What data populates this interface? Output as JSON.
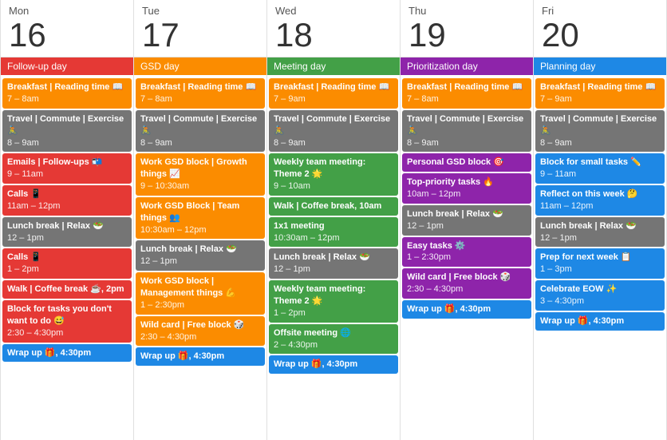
{
  "days": [
    {
      "name": "Mon",
      "number": "16",
      "tag": "Follow-up day",
      "tag_color": "bg-tag-red",
      "events": [
        {
          "title": "Breakfast | Reading time 📖",
          "time": "7 – 8am",
          "color": "bg-orange"
        },
        {
          "title": "Travel | Commute | Exercise 🚴",
          "time": "8 – 9am",
          "color": "bg-gray"
        },
        {
          "title": "Emails | Follow-ups 📬",
          "time": "9 – 11am",
          "color": "bg-red"
        },
        {
          "title": "Calls 📱",
          "time": "11am – 12pm",
          "color": "bg-red"
        },
        {
          "title": "Lunch break | Relax 🥗",
          "time": "12 – 1pm",
          "color": "bg-gray"
        },
        {
          "title": "Calls 📱",
          "time": "1 – 2pm",
          "color": "bg-red"
        },
        {
          "title": "Walk | Coffee break ☕, 2pm",
          "time": "",
          "color": "bg-red"
        },
        {
          "title": "Block for tasks you don't want to do 😅",
          "time": "2:30 – 4:30pm",
          "color": "bg-red"
        },
        {
          "title": "Wrap up 🎁, 4:30pm",
          "time": "",
          "color": "bg-blue"
        }
      ]
    },
    {
      "name": "Tue",
      "number": "17",
      "tag": "GSD day",
      "tag_color": "bg-tag-orange",
      "events": [
        {
          "title": "Breakfast | Reading time 📖",
          "time": "7 – 8am",
          "color": "bg-orange"
        },
        {
          "title": "Travel | Commute | Exercise 🚴",
          "time": "8 – 9am",
          "color": "bg-gray"
        },
        {
          "title": "Work GSD block | Growth things 📈",
          "time": "9 – 10:30am",
          "color": "bg-orange"
        },
        {
          "title": "Work GSD Block | Team things 👥",
          "time": "10:30am – 12pm",
          "color": "bg-orange"
        },
        {
          "title": "Lunch break | Relax 🥗",
          "time": "12 – 1pm",
          "color": "bg-gray"
        },
        {
          "title": "Work GSD block | Management things 💪",
          "time": "1 – 2:30pm",
          "color": "bg-orange"
        },
        {
          "title": "Wild card | Free block 🎲",
          "time": "2:30 – 4:30pm",
          "color": "bg-orange"
        },
        {
          "title": "Wrap up 🎁, 4:30pm",
          "time": "",
          "color": "bg-blue"
        }
      ]
    },
    {
      "name": "Wed",
      "number": "18",
      "tag": "Meeting day",
      "tag_color": "bg-tag-green",
      "events": [
        {
          "title": "Breakfast | Reading time 📖",
          "time": "7 – 9am",
          "color": "bg-orange"
        },
        {
          "title": "Travel | Commute | Exercise 🚴",
          "time": "8 – 9am",
          "color": "bg-gray"
        },
        {
          "title": "Weekly team meeting: Theme 2 🌟",
          "time": "9 – 10am",
          "color": "bg-green"
        },
        {
          "title": "Walk | Coffee break, 10am",
          "time": "",
          "color": "bg-green"
        },
        {
          "title": "1x1 meeting",
          "time": "10:30am – 12pm",
          "color": "bg-green"
        },
        {
          "title": "Lunch break | Relax 🥗",
          "time": "12 – 1pm",
          "color": "bg-gray"
        },
        {
          "title": "Weekly team meeting: Theme 2 🌟",
          "time": "1 – 2pm",
          "color": "bg-green"
        },
        {
          "title": "Offsite meeting 🌐",
          "time": "2 – 4:30pm",
          "color": "bg-green"
        },
        {
          "title": "Wrap up 🎁, 4:30pm",
          "time": "",
          "color": "bg-blue"
        }
      ]
    },
    {
      "name": "Thu",
      "number": "19",
      "tag": "Prioritization day",
      "tag_color": "bg-tag-purple",
      "events": [
        {
          "title": "Breakfast | Reading time 📖",
          "time": "7 – 8am",
          "color": "bg-orange"
        },
        {
          "title": "Travel | Commute | Exercise 🚴",
          "time": "8 – 9am",
          "color": "bg-gray"
        },
        {
          "title": "Personal GSD block 🎯",
          "time": "",
          "color": "bg-purple"
        },
        {
          "title": "Top-priority tasks 🔥",
          "time": "10am – 12pm",
          "color": "bg-purple"
        },
        {
          "title": "Lunch break | Relax 🥗",
          "time": "12 – 1pm",
          "color": "bg-gray"
        },
        {
          "title": "Easy tasks ⚙️",
          "time": "1 – 2:30pm",
          "color": "bg-purple"
        },
        {
          "title": "Wild card | Free block 🎲",
          "time": "2:30 – 4:30pm",
          "color": "bg-purple"
        },
        {
          "title": "Wrap up 🎁, 4:30pm",
          "time": "",
          "color": "bg-blue"
        }
      ]
    },
    {
      "name": "Fri",
      "number": "20",
      "tag": "Planning day",
      "tag_color": "bg-tag-blue",
      "events": [
        {
          "title": "Breakfast | Reading time 📖",
          "time": "7 – 9am",
          "color": "bg-orange"
        },
        {
          "title": "Travel | Commute | Exercise 🚴",
          "time": "8 – 9am",
          "color": "bg-gray"
        },
        {
          "title": "Block for small tasks ✏️",
          "time": "9 – 11am",
          "color": "bg-blue"
        },
        {
          "title": "Reflect on this week 🤔",
          "time": "11am – 12pm",
          "color": "bg-blue"
        },
        {
          "title": "Lunch break | Relax 🥗",
          "time": "12 – 1pm",
          "color": "bg-gray"
        },
        {
          "title": "Prep for next week 📋",
          "time": "1 – 3pm",
          "color": "bg-blue"
        },
        {
          "title": "Celebrate EOW ✨",
          "time": "3 – 4:30pm",
          "color": "bg-blue"
        },
        {
          "title": "Wrap up 🎁, 4:30pm",
          "time": "",
          "color": "bg-blue"
        }
      ]
    }
  ]
}
